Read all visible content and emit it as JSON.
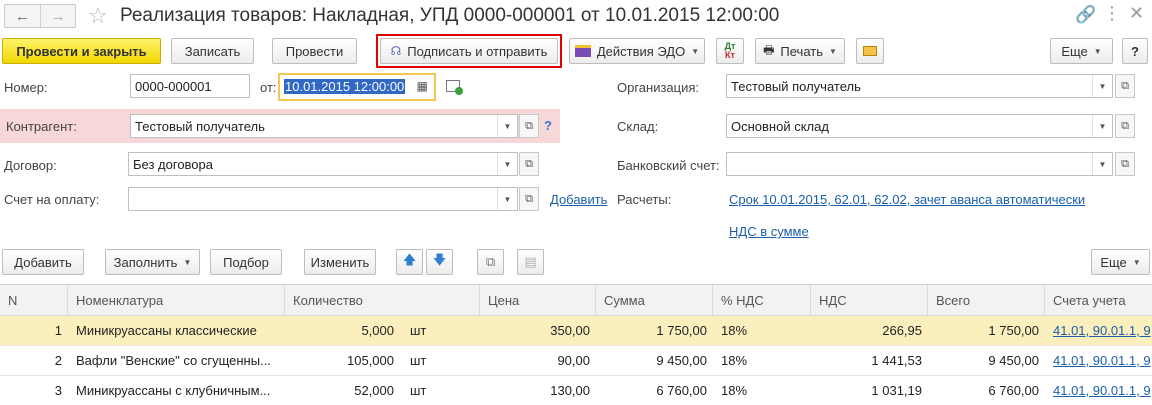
{
  "window": {
    "title": "Реализация товаров: Накладная, УПД 0000-000001 от 10.01.2015 12:00:00"
  },
  "toolbar": {
    "post_close": "Провести и закрыть",
    "save": "Записать",
    "post": "Провести",
    "sign_send": "Подписать и отправить",
    "edo": "Действия ЭДО",
    "print": "Печать",
    "more": "Еще",
    "help": "?",
    "dtkt_top": "Дт",
    "dtkt_bottom": "Кт"
  },
  "form": {
    "number_label": "Номер:",
    "number_value": "0000-000001",
    "date_label": "от:",
    "date_value": "10.01.2015 12:00:00",
    "contractor_label": "Контрагент:",
    "contractor_value": "Тестовый получатель",
    "contractor_hint": "?",
    "contract_label": "Договор:",
    "contract_value": "Без договора",
    "invoice_label": "Счет на оплату:",
    "invoice_value": "",
    "add_link": "Добавить",
    "org_label": "Организация:",
    "org_value": "Тестовый получатель",
    "warehouse_label": "Склад:",
    "warehouse_value": "Основной склад",
    "bank_label": "Банковский счет:",
    "bank_value": "",
    "settlements_label": "Расчеты:",
    "settlements_link": "Срок 10.01.2015, 62.01, 62.02, зачет аванса автоматически",
    "vat_link": "НДС в сумме"
  },
  "table_toolbar": {
    "add": "Добавить",
    "fill": "Заполнить",
    "select": "Подбор",
    "change": "Изменить",
    "more": "Еще"
  },
  "table": {
    "columns": [
      "N",
      "Номенклатура",
      "Количество",
      "Цена",
      "Сумма",
      "% НДС",
      "НДС",
      "Всего",
      "Счета учета"
    ],
    "rows": [
      {
        "n": "1",
        "name": "Миникруассаны классические",
        "qty": "5,000",
        "unit": "шт",
        "price": "350,00",
        "sum": "1 750,00",
        "vat_rate": "18%",
        "vat": "266,95",
        "total": "1 750,00",
        "accounts": "41.01, 90.01.1, 9"
      },
      {
        "n": "2",
        "name": "Вафли \"Венские\" со сгущенны...",
        "qty": "105,000",
        "unit": "шт",
        "price": "90,00",
        "sum": "9 450,00",
        "vat_rate": "18%",
        "vat": "1 441,53",
        "total": "9 450,00",
        "accounts": "41.01, 90.01.1, 9"
      },
      {
        "n": "3",
        "name": "Миникруассаны с клубничным...",
        "qty": "52,000",
        "unit": "шт",
        "price": "130,00",
        "sum": "6 760,00",
        "vat_rate": "18%",
        "vat": "1 031,19",
        "total": "6 760,00",
        "accounts": "41.01, 90.01.1, 9"
      }
    ]
  },
  "colors": {
    "primary_button": "#f2d800",
    "highlight_border": "#e00000",
    "selected_row": "#fbefbd",
    "error_field_bg": "#f8d7d9",
    "link": "#1a5fa8"
  }
}
